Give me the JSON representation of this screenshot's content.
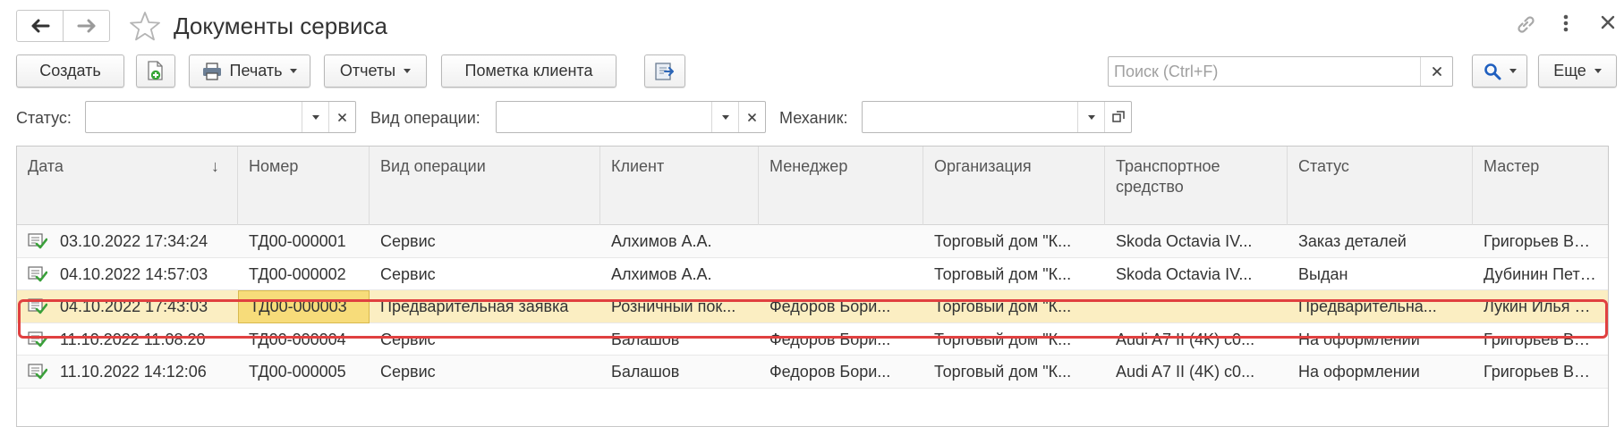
{
  "window": {
    "title": "Документы сервиса"
  },
  "toolbar": {
    "create": "Создать",
    "print": "Печать",
    "reports": "Отчеты",
    "client_mark": "Пометка клиента",
    "more": "Еще"
  },
  "search": {
    "placeholder": "Поиск (Ctrl+F)",
    "value": ""
  },
  "filters": {
    "status_label": "Статус:",
    "operation_label": "Вид операции:",
    "mechanic_label": "Механик:"
  },
  "table": {
    "columns": [
      "Дата",
      "Номер",
      "Вид операции",
      "Клиент",
      "Менеджер",
      "Организация",
      "Транспортное средство",
      "Статус",
      "Мастер"
    ],
    "rows": [
      [
        "03.10.2022 17:34:24",
        "ТД00-000001",
        "Сервис",
        "Алхимов А.А.",
        "",
        "Торговый дом \"К...",
        "Skoda Octavia IV...",
        "Заказ деталей",
        "Григорьев Витал"
      ],
      [
        "04.10.2022 14:57:03",
        "ТД00-000002",
        "Сервис",
        "Алхимов А.А.",
        "",
        "Торговый дом \"К...",
        "Skoda Octavia IV...",
        "Выдан",
        "Дубинин Петр Ни"
      ],
      [
        "04.10.2022 17:43:03",
        "ТД00-000003",
        "Предварительная заявка",
        "Розничный пок...",
        "Федоров Бори...",
        "Торговый дом \"К...",
        "",
        "Предварительна...",
        "Лукин Илья Фед"
      ],
      [
        "11.10.2022 11:08:20",
        "ТД00-000004",
        "Сервис",
        "Балашов",
        "Федоров Бори...",
        "Торговый дом \"К...",
        "Audi A7 II (4K) c0...",
        "На оформлении",
        "Григорьев Витал"
      ],
      [
        "11.10.2022 14:12:06",
        "ТД00-000005",
        "Сервис",
        "Балашов",
        "Федоров Бори...",
        "Торговый дом \"К...",
        "Audi A7 II (4K) c0...",
        "На оформлении",
        "Григорьев Витал"
      ]
    ],
    "selected_row": 2
  },
  "colors": {
    "selected_row": "#fbeec2",
    "current_cell": "#f7dc7a",
    "highlight_outline": "#e04040",
    "search_icon": "#1f5fbf",
    "doc_icon_check": "#3aa03a"
  },
  "icons": {
    "back": "arrow-left-icon",
    "forward": "arrow-right-icon",
    "favorite": "star-icon",
    "link": "link-icon",
    "menu": "more-vertical-icon",
    "close": "close-icon",
    "add_copy": "add-document-icon",
    "print": "printer-icon",
    "export": "export-icon",
    "search": "search-icon",
    "row_doc": "posted-document-icon"
  }
}
